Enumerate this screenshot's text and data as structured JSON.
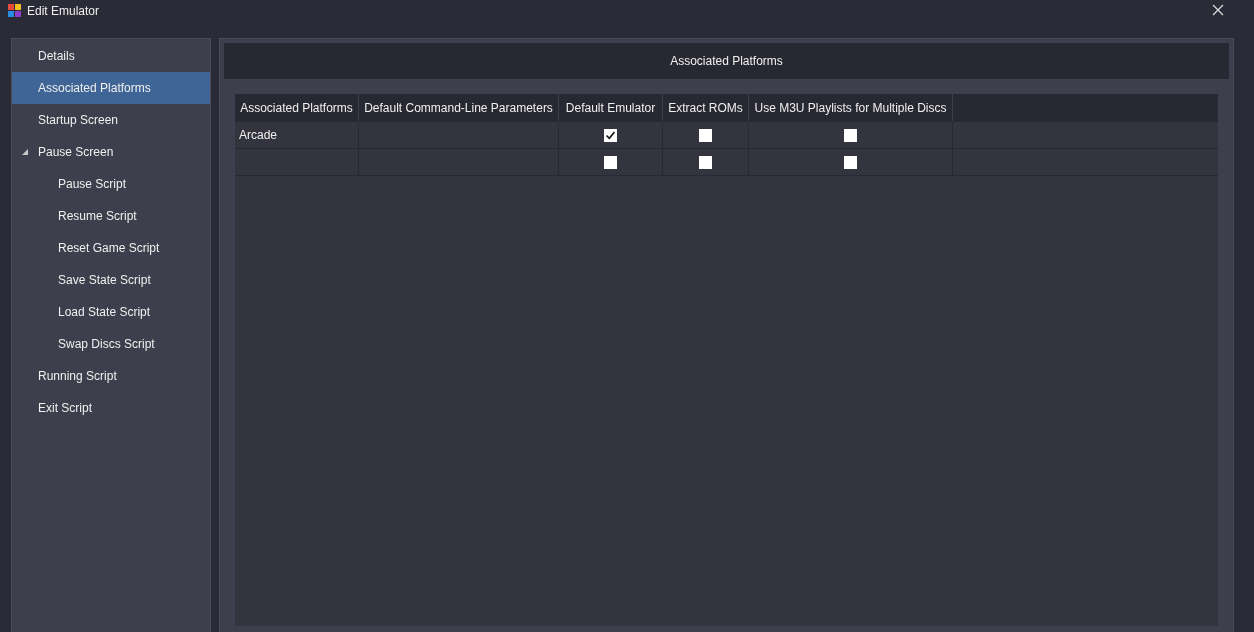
{
  "window": {
    "title": "Edit Emulator"
  },
  "sidebar": {
    "items": [
      {
        "label": "Details",
        "selected": false
      },
      {
        "label": "Associated Platforms",
        "selected": true
      },
      {
        "label": "Startup Screen",
        "selected": false
      },
      {
        "label": "Pause Screen",
        "selected": false,
        "expanded": true,
        "children": [
          {
            "label": "Pause Script",
            "selected": false
          },
          {
            "label": "Resume Script",
            "selected": false
          },
          {
            "label": "Reset Game Script",
            "selected": false
          },
          {
            "label": "Save State Script",
            "selected": false
          },
          {
            "label": "Load State Script",
            "selected": false
          },
          {
            "label": "Swap Discs Script",
            "selected": false
          }
        ]
      },
      {
        "label": "Running Script",
        "selected": false
      },
      {
        "label": "Exit Script",
        "selected": false
      }
    ]
  },
  "panel": {
    "title": "Associated Platforms"
  },
  "table": {
    "columns": [
      "Associated Platforms",
      "Default Command-Line Parameters",
      "Default Emulator",
      "Extract ROMs",
      "Use M3U Playlists for Multiple Discs"
    ],
    "rows": [
      {
        "platform": "Arcade",
        "parameters": "",
        "default_emulator": true,
        "extract_roms": false,
        "use_m3u": false
      },
      {
        "platform": "",
        "parameters": "",
        "default_emulator": false,
        "extract_roms": false,
        "use_m3u": false
      }
    ]
  }
}
